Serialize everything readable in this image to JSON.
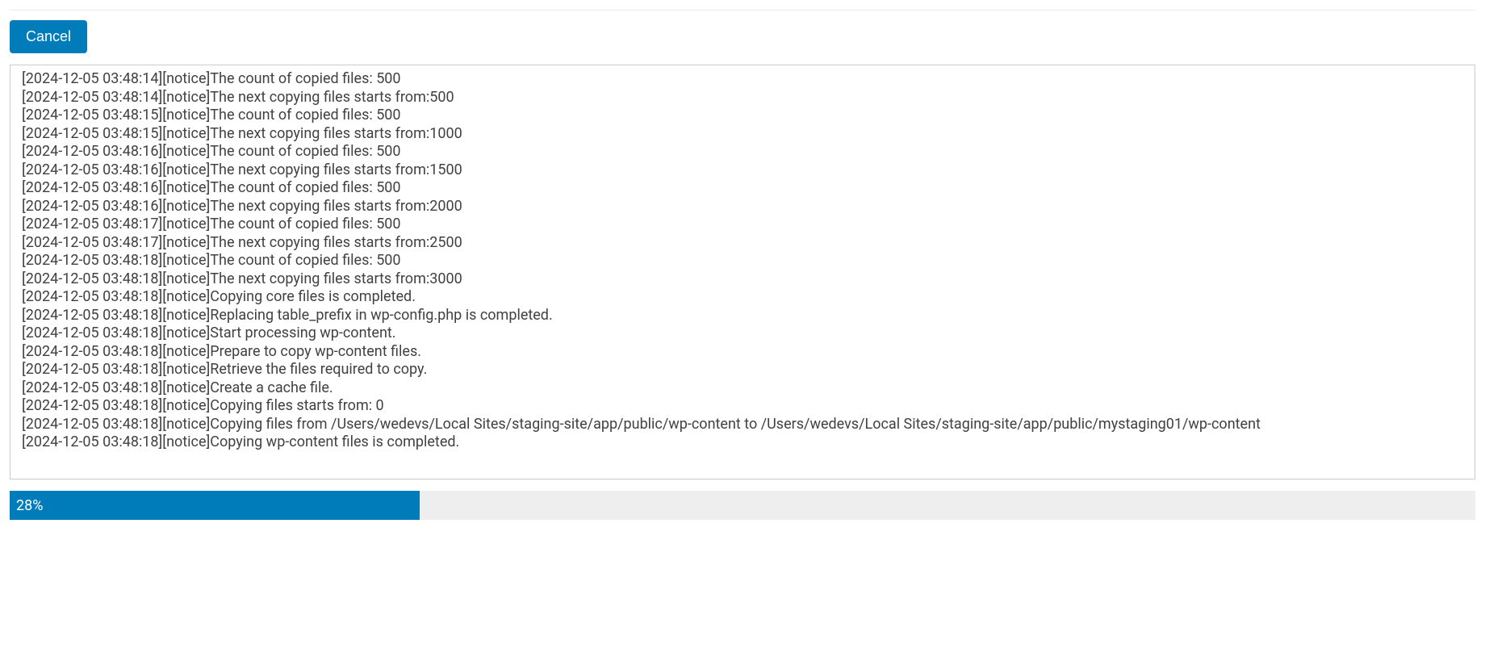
{
  "buttons": {
    "cancel": "Cancel"
  },
  "log_lines": [
    "[2024-12-05 03:48:14][notice]The count of copied files: 500",
    "[2024-12-05 03:48:14][notice]The next copying files starts from:500",
    "[2024-12-05 03:48:15][notice]The count of copied files: 500",
    "[2024-12-05 03:48:15][notice]The next copying files starts from:1000",
    "[2024-12-05 03:48:16][notice]The count of copied files: 500",
    "[2024-12-05 03:48:16][notice]The next copying files starts from:1500",
    "[2024-12-05 03:48:16][notice]The count of copied files: 500",
    "[2024-12-05 03:48:16][notice]The next copying files starts from:2000",
    "[2024-12-05 03:48:17][notice]The count of copied files: 500",
    "[2024-12-05 03:48:17][notice]The next copying files starts from:2500",
    "[2024-12-05 03:48:18][notice]The count of copied files: 500",
    "[2024-12-05 03:48:18][notice]The next copying files starts from:3000",
    "[2024-12-05 03:48:18][notice]Copying core files is completed.",
    "[2024-12-05 03:48:18][notice]Replacing table_prefix in wp-config.php is completed.",
    "[2024-12-05 03:48:18][notice]Start processing wp-content.",
    "[2024-12-05 03:48:18][notice]Prepare to copy wp-content files.",
    "[2024-12-05 03:48:18][notice]Retrieve the files required to copy.",
    "[2024-12-05 03:48:18][notice]Create a cache file.",
    "[2024-12-05 03:48:18][notice]Copying files starts from: 0",
    "[2024-12-05 03:48:18][notice]Copying files from /Users/wedevs/Local Sites/staging-site/app/public/wp-content to /Users/wedevs/Local Sites/staging-site/app/public/mystaging01/wp-content",
    "[2024-12-05 03:48:18][notice]Copying wp-content files is completed."
  ],
  "progress": {
    "percent": 28,
    "label": "28%"
  }
}
